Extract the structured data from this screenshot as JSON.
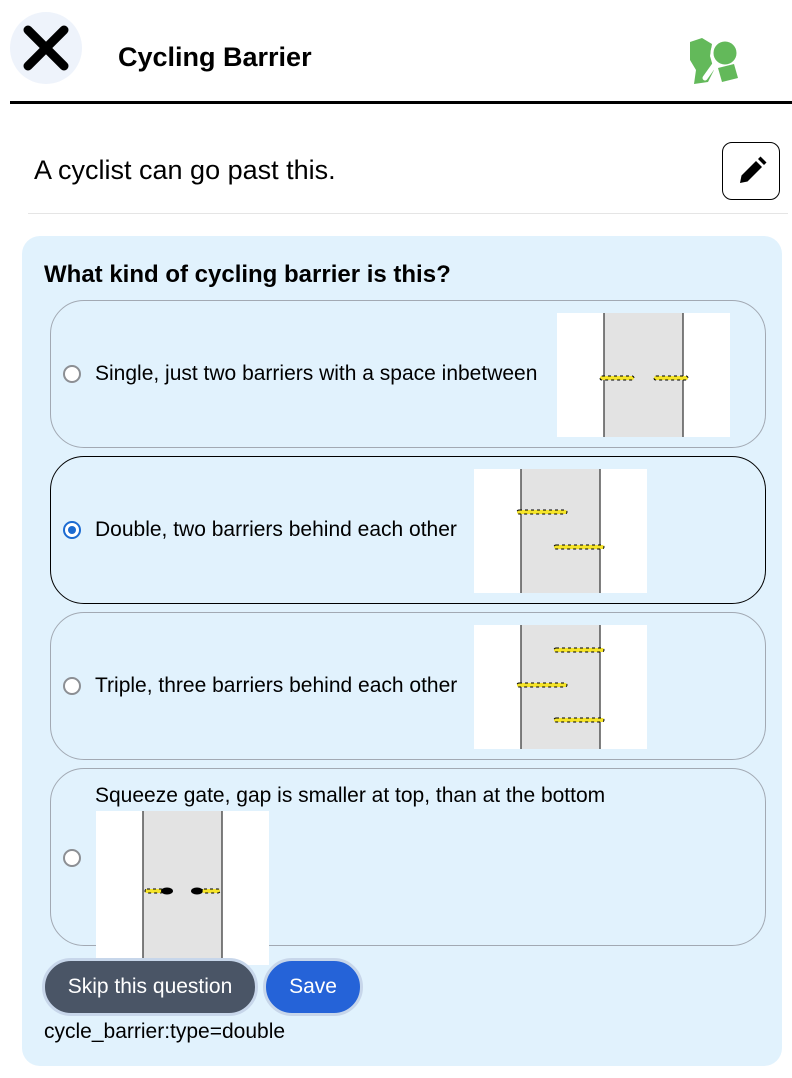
{
  "header": {
    "title": "Cycling Barrier",
    "close_icon": "close-icon",
    "logo_icon": "mapcomplete-logo-icon"
  },
  "rendering": {
    "text": "A cyclist can go past this.",
    "edit_icon": "pencil-icon"
  },
  "question": {
    "title": "What kind of cycling barrier is this?",
    "options": [
      {
        "label": "Single, just two barriers with a space inbetween",
        "checked": false,
        "image": "single-barrier-image"
      },
      {
        "label": "Double, two barriers behind each other",
        "checked": true,
        "image": "double-barrier-image"
      },
      {
        "label": "Triple, three barriers behind each other",
        "checked": false,
        "image": "triple-barrier-image"
      },
      {
        "label": "Squeeze gate, gap is smaller at top, than at the bottom",
        "checked": false,
        "image": "squeeze-gate-image"
      }
    ],
    "skip_label": "Skip this question",
    "save_label": "Save",
    "tag_text": "cycle_barrier:type=double"
  },
  "colors": {
    "card_bg": "#e1f2fd",
    "accent": "#2563d8",
    "radio_checked": "#1c6bd1",
    "skip_bg": "#4a5566",
    "barrier_yellow": "#f5e42a",
    "road_gray": "#e3e3e3"
  }
}
